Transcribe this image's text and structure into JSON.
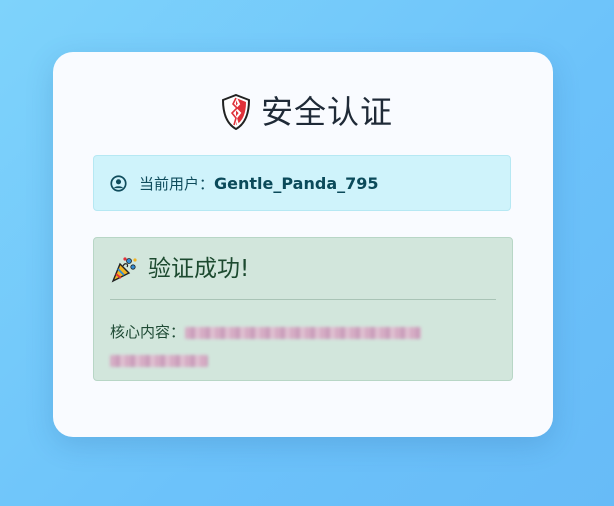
{
  "header": {
    "title": "安全认证",
    "icon": "shield-icon"
  },
  "user": {
    "label": "当前用户：",
    "name": "Gentle_Panda_795",
    "icon": "user-circle-icon"
  },
  "result": {
    "title": "验证成功!",
    "icon": "party-popper-icon",
    "content_label": "核心内容：",
    "content_value_redacted": true
  },
  "colors": {
    "background": "#74c8fa",
    "card": "#f9fbff",
    "user_box": "#cff3fb",
    "success_box": "#d2e6dc",
    "shield_red": "#e0313a"
  }
}
